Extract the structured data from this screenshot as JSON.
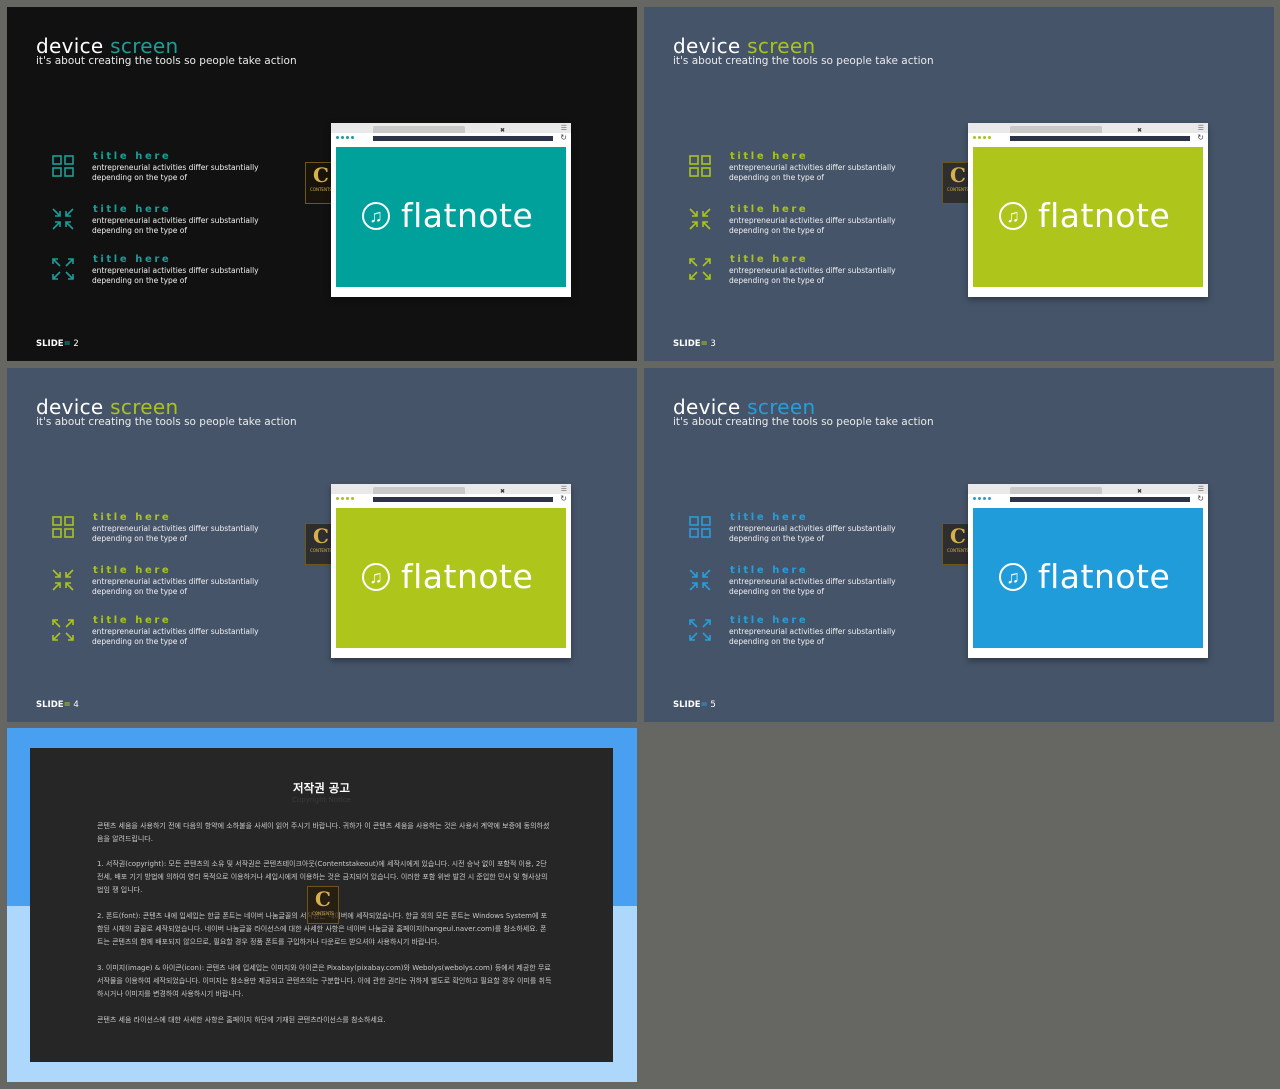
{
  "colors": {
    "teal": "#1a9e98",
    "lime": "#aac31c",
    "blue": "#2a9cd8",
    "slide_dark_bg": "#111111",
    "slide_navy_bg": "#46546a"
  },
  "slides": [
    {
      "title_word1": "device",
      "title_word2": "screen",
      "subtitle": "it's about creating the tools so people take action",
      "items": [
        {
          "icon": "grid-icon",
          "title": "title here",
          "desc": "entrepreneurial activities differ substantially depending on the type of"
        },
        {
          "icon": "compress-arrows-icon",
          "title": "title here",
          "desc": "entrepreneurial activities differ substantially depending on the type of"
        },
        {
          "icon": "expand-arrows-icon",
          "title": "title here",
          "desc": "entrepreneurial activities differ substantially depending on the type of"
        }
      ],
      "screen_logo_icon": "music-note-icon",
      "screen_logo_text": "flatnote",
      "badge_letter": "C",
      "badge_text": "CONTENTS",
      "slide_label": "SLIDE",
      "slide_sep": "=",
      "slide_number": "2"
    },
    {
      "title_word1": "device",
      "title_word2": "screen",
      "subtitle": "it's about creating the tools so people take action",
      "items": [
        {
          "icon": "grid-icon",
          "title": "title here",
          "desc": "entrepreneurial activities differ substantially depending on the type of"
        },
        {
          "icon": "compress-arrows-icon",
          "title": "title here",
          "desc": "entrepreneurial activities differ substantially depending on the type of"
        },
        {
          "icon": "expand-arrows-icon",
          "title": "title here",
          "desc": "entrepreneurial activities differ substantially depending on the type of"
        }
      ],
      "screen_logo_icon": "music-note-icon",
      "screen_logo_text": "flatnote",
      "badge_letter": "C",
      "badge_text": "CONTENTS",
      "slide_label": "SLIDE",
      "slide_sep": "=",
      "slide_number": "3"
    },
    {
      "title_word1": "device",
      "title_word2": "screen",
      "subtitle": "it's about creating the tools so people take action",
      "items": [
        {
          "icon": "grid-icon",
          "title": "title here",
          "desc": "entrepreneurial activities differ substantially depending on the type of"
        },
        {
          "icon": "compress-arrows-icon",
          "title": "title here",
          "desc": "entrepreneurial activities differ substantially depending on the type of"
        },
        {
          "icon": "expand-arrows-icon",
          "title": "title here",
          "desc": "entrepreneurial activities differ substantially depending on the type of"
        }
      ],
      "screen_logo_icon": "music-note-icon",
      "screen_logo_text": "flatnote",
      "badge_letter": "C",
      "badge_text": "CONTENTS",
      "slide_label": "SLIDE",
      "slide_sep": "=",
      "slide_number": "4"
    },
    {
      "title_word1": "device",
      "title_word2": "screen",
      "subtitle": "it's about creating the tools so people take action",
      "items": [
        {
          "icon": "grid-icon",
          "title": "title here",
          "desc": "entrepreneurial activities differ substantially depending on the type of"
        },
        {
          "icon": "compress-arrows-icon",
          "title": "title here",
          "desc": "entrepreneurial activities differ substantially depending on the type of"
        },
        {
          "icon": "expand-arrows-icon",
          "title": "title here",
          "desc": "entrepreneurial activities differ substantially depending on the type of"
        }
      ],
      "screen_logo_icon": "music-note-icon",
      "screen_logo_text": "flatnote",
      "badge_letter": "C",
      "badge_text": "CONTENTS",
      "slide_label": "SLIDE",
      "slide_sep": "=",
      "slide_number": "5"
    }
  ],
  "copyright": {
    "title": "저작권 공고",
    "subtitle": "Copyright Notice",
    "badge_letter": "C",
    "badge_text": "CONTENTS",
    "paragraphs": [
      "콘텐츠 세움을 사용하기 전에 다음의 항약에 소하불을 사세이 읽어 주시기 바랍니다. 귀하가 이 콘텐츠 세움을 사용하는 것은 사용서 계약에 보증에 동의하셨음을 알려드립니다.",
      "1. 서작권(copyright): 모든 콘텐츠의 소유 및 서작권은 콘텐츠테이크아웃(Contentstakeout)에 세작시에게 있습니다. 시전 승낙 없이 포함적 이용, 2단전세, 배포 기기 방법에 의하여 영리 목적으로 이용하거나 세입시에게 이용하는 것은 금지되어 있습니다. 이러한 포함 위반 발견 시 준입한 민사 및 형사상의 법임 쟁 입니다.",
      "2. 폰트(font): 콘텐츠 내에 입세입는 한글 폰트는 네이버 나눔글꼴의 서작권은 네이버에 세작되었습니다. 한글 외의 모든 폰트는 Windows System에 포함된 시체의 글꼴로 세작되었습니다. 네이버 나눔글꼴 라이선스에 대한 사세한 사항은 네이버 나눔글꼴 홈페이지(hangeul.naver.com)를 참소하세요. 폰트는 콘텐츠의 함께 배포되지 않으므로, 필요할 경우 정품 폰트를 구입하거나 다운로드 받으셔야 사용하시기 바랍니다.",
      "3. 이미지(image) & 아이콘(icon): 콘텐츠 내에 입세입는 이미지와 아이콘은 Pixabay(pixabay.com)와 Webolys(webolys.com) 등에서 제공한 무료 서작물을 이용하여 세작되었습니다. 이미지는 참소용만 제공되고 콘텐츠의는 구분합니다. 이에 관한 권리는 귀하게 별도로 확인하고 필요할 경우 이미를 취득하시거나 이미지를 변경하여 사용하시기 바랍니다.",
      "콘텐츠 세움 라이선스에 대한 사세한 사항은 홈페이지 하단에 기재된 콘텐츠라이선스를 참소하세요."
    ]
  }
}
